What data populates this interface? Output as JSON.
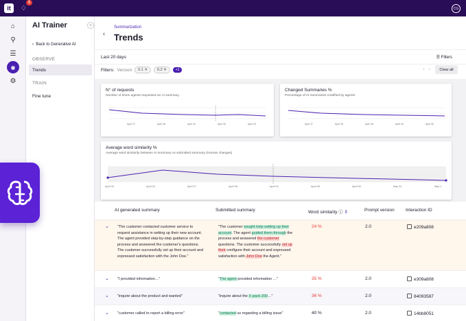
{
  "topbar": {
    "logo_text": "it",
    "notif_count": "8",
    "avatar_text": "CG"
  },
  "sidebar": {
    "title": "AI Trainer",
    "back_label": "Back to Generative AI",
    "observe_section": "OBSERVE",
    "trends_item": "Trends",
    "train_section": "TRAIN",
    "finetune_item": "Fine tune"
  },
  "header": {
    "breadcrumb": "Summarization",
    "title": "Trends"
  },
  "toolbar": {
    "range_label": "Last 20 days",
    "filters_label": "Filters"
  },
  "filter_bar": {
    "label": "Filters:",
    "version_label": "Version",
    "chips": [
      "0.1",
      "0.2"
    ],
    "more_chip": "+1",
    "clear_label": "Clear all"
  },
  "charts": [
    {
      "title": "N° of requests",
      "subtitle": "Number of times agents requested an AI summary."
    },
    {
      "title": "Changed Summaries %",
      "subtitle": "Percentage of AI-summaries modified by agents"
    },
    {
      "title": "Average word similarity %",
      "subtitle": "Average word similarity between AI summary vs submitted summary (Human changes)"
    }
  ],
  "chart3_ticks": [
    "April 26",
    "April 04",
    "April 27",
    "April 28",
    "April 02",
    "April 28",
    "April 30",
    "May 31",
    "May 1"
  ],
  "table": {
    "headers": {
      "ai": "AI generated summary",
      "submitted": "Submitted summary",
      "similarity": "Word similarity",
      "version": "Prompt version",
      "interaction": "Interaction ID"
    },
    "rows": [
      {
        "ai": "\"The customer contacted customer service to request assistance in setting up their new account. The agent provided step-by-step guidance on the process and answered the customer's questions. The customer successfully set up their account and expressed satisfaction with the John Doe.\"",
        "similarity": "24 %",
        "version": "2.0",
        "id": "e209a808"
      },
      {
        "ai": "\"I provided information…\"",
        "similarity": "35 %",
        "version": "2.0",
        "id": "e309a808"
      },
      {
        "ai": "\"inquire about the product and wanted\"",
        "similarity": "36 %",
        "version": "2.0",
        "id": "84093587"
      },
      {
        "ai": "\"customer called to report a billing error\"",
        "similarity": "40 %",
        "version": "2.0",
        "id": "14bb8051"
      }
    ],
    "submitted": {
      "r0": {
        "a": "\"The customer ",
        "b": "sought help setting up their account",
        "c": ". The agent ",
        "d": "guided them through",
        "e": " the process and answered ",
        "f": "the customer",
        "g": " questions. The customer successfully ",
        "h": "set up their",
        "i": " configure their account and expressed satisfaction with ",
        "j": "John Doe",
        "k": " the Agent.\""
      },
      "r1": {
        "a": "\"",
        "b": "The agent",
        "c": " provided information …\""
      },
      "r2": {
        "a": "\"inquire about the ",
        "b": "X pack 200",
        "c": "…\""
      },
      "r3": {
        "a": "\"",
        "b": "contacted",
        "c": " us regarding a billing issue\""
      }
    }
  },
  "colors": {
    "accent": "#4a1fb0",
    "topbar": "#2a0d57",
    "danger": "#e53935"
  }
}
